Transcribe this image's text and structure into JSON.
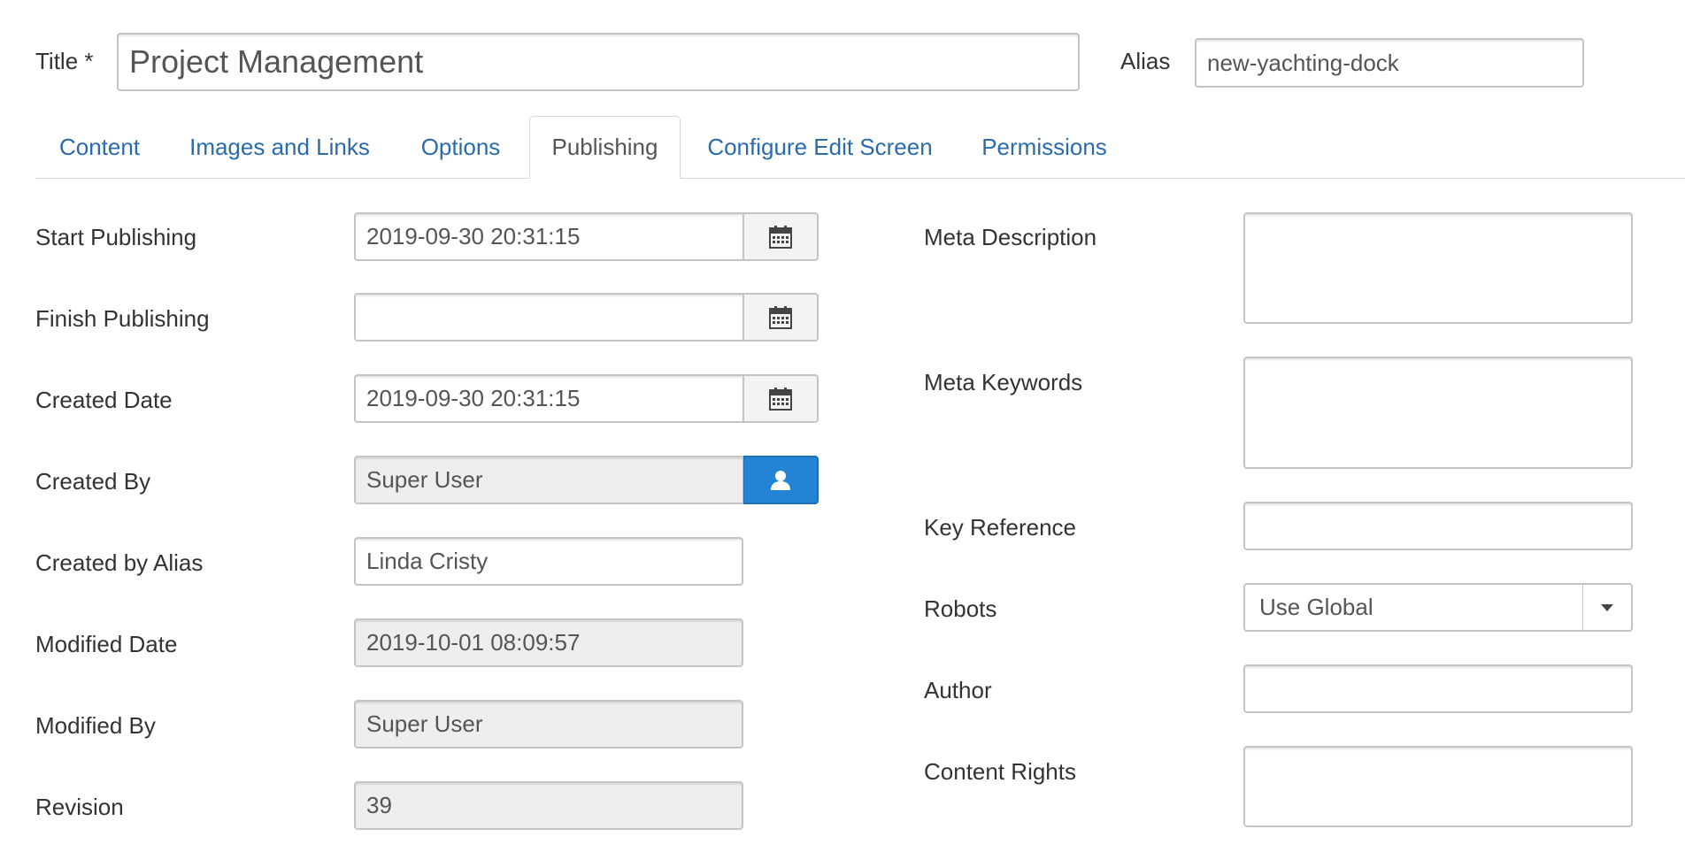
{
  "title_field": {
    "label": "Title *",
    "value": "Project Management"
  },
  "alias_field": {
    "label": "Alias",
    "value": "new-yachting-dock"
  },
  "tabs": [
    {
      "label": "Content"
    },
    {
      "label": "Images and Links"
    },
    {
      "label": "Options"
    },
    {
      "label": "Publishing"
    },
    {
      "label": "Configure Edit Screen"
    },
    {
      "label": "Permissions"
    }
  ],
  "active_tab": "Publishing",
  "left_fields": {
    "start_publishing": {
      "label": "Start Publishing",
      "value": "2019-09-30 20:31:15",
      "icon": "calendar-icon"
    },
    "finish_publishing": {
      "label": "Finish Publishing",
      "value": "",
      "icon": "calendar-icon"
    },
    "created_date": {
      "label": "Created Date",
      "value": "2019-09-30 20:31:15",
      "icon": "calendar-icon"
    },
    "created_by": {
      "label": "Created By",
      "value": "Super User",
      "icon": "user-icon"
    },
    "created_by_alias": {
      "label": "Created by Alias",
      "value": "Linda Cristy"
    },
    "modified_date": {
      "label": "Modified Date",
      "value": "2019-10-01 08:09:57"
    },
    "modified_by": {
      "label": "Modified By",
      "value": "Super User"
    },
    "revision": {
      "label": "Revision",
      "value": "39"
    }
  },
  "right_fields": {
    "meta_description": {
      "label": "Meta Description",
      "value": ""
    },
    "meta_keywords": {
      "label": "Meta Keywords",
      "value": ""
    },
    "key_reference": {
      "label": "Key Reference",
      "value": ""
    },
    "robots": {
      "label": "Robots",
      "value": "Use Global"
    },
    "author": {
      "label": "Author",
      "value": ""
    },
    "content_rights": {
      "label": "Content Rights",
      "value": ""
    }
  },
  "colors": {
    "link": "#2a6bad",
    "primary_button": "#2384d3",
    "readonly_bg": "#eeeeee"
  }
}
